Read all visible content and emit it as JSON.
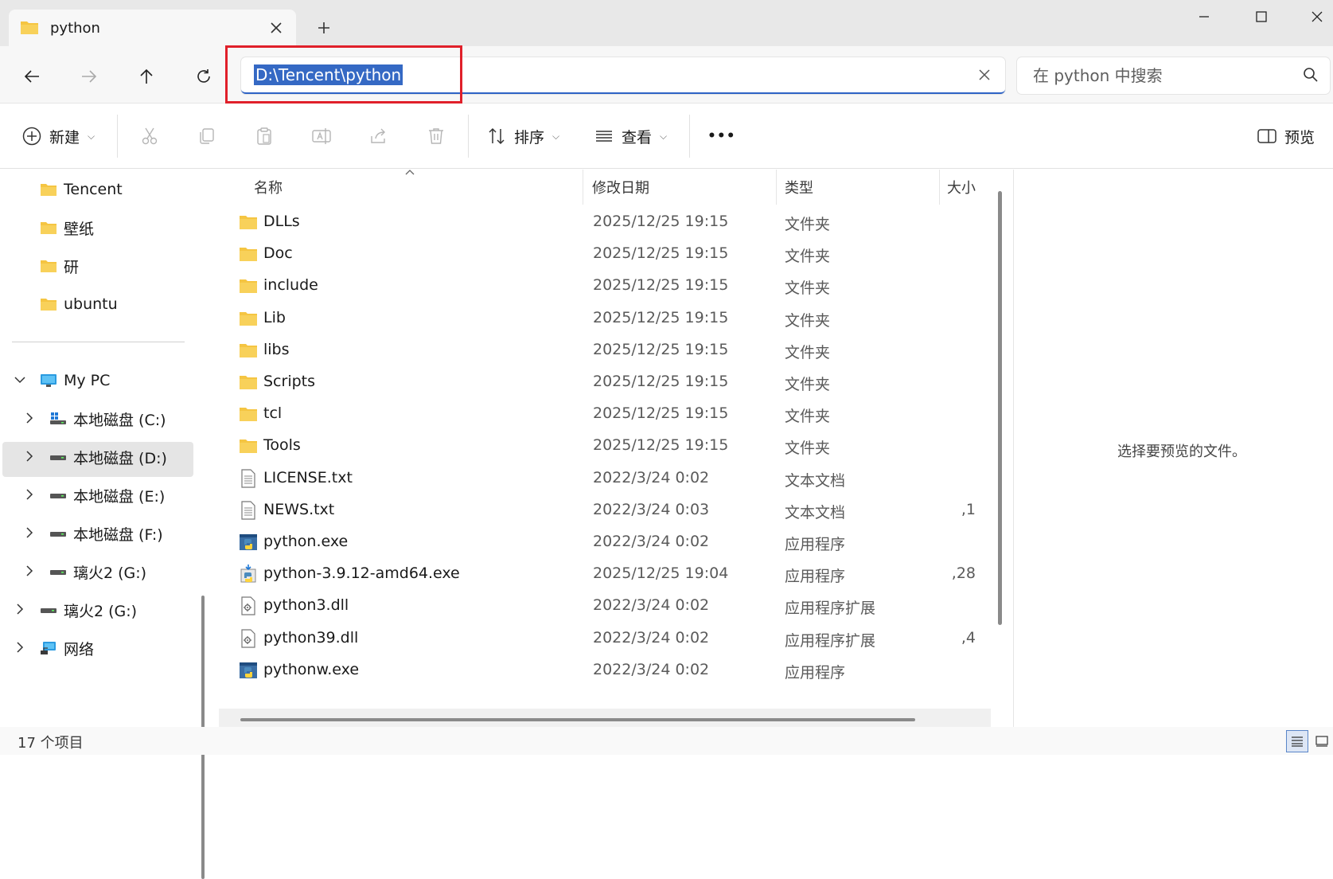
{
  "tab": {
    "title": "python"
  },
  "address": {
    "path": "D:\\Tencent\\python"
  },
  "search": {
    "placeholder": "在 python 中搜索"
  },
  "toolbar": {
    "new_label": "新建",
    "sort_label": "排序",
    "view_label": "查看",
    "more_label": "•••",
    "preview_label": "预览"
  },
  "sidebar": {
    "quick_items": [
      {
        "label": "Tencent"
      },
      {
        "label": "壁纸"
      },
      {
        "label": "研"
      },
      {
        "label": "ubuntu"
      }
    ],
    "tree": [
      {
        "label": "My PC",
        "icon": "monitor-icon",
        "expanded": true
      },
      {
        "label": "本地磁盘 (C:)",
        "icon": "windows-drive-icon"
      },
      {
        "label": "本地磁盘 (D:)",
        "icon": "drive-icon",
        "selected": true
      },
      {
        "label": "本地磁盘 (E:)",
        "icon": "drive-icon"
      },
      {
        "label": "本地磁盘 (F:)",
        "icon": "drive-icon"
      },
      {
        "label": "璃火2 (G:)",
        "icon": "drive-icon"
      },
      {
        "label": "璃火2 (G:)",
        "icon": "drive-icon"
      },
      {
        "label": "网络",
        "icon": "network-icon"
      }
    ]
  },
  "columns": {
    "name": "名称",
    "date": "修改日期",
    "type": "类型",
    "size": "大小"
  },
  "files": [
    {
      "name": "DLLs",
      "date": "2025/12/25 19:15",
      "type": "文件夹",
      "size": "",
      "icon": "folder"
    },
    {
      "name": "Doc",
      "date": "2025/12/25 19:15",
      "type": "文件夹",
      "size": "",
      "icon": "folder"
    },
    {
      "name": "include",
      "date": "2025/12/25 19:15",
      "type": "文件夹",
      "size": "",
      "icon": "folder"
    },
    {
      "name": "Lib",
      "date": "2025/12/25 19:15",
      "type": "文件夹",
      "size": "",
      "icon": "folder"
    },
    {
      "name": "libs",
      "date": "2025/12/25 19:15",
      "type": "文件夹",
      "size": "",
      "icon": "folder"
    },
    {
      "name": "Scripts",
      "date": "2025/12/25 19:15",
      "type": "文件夹",
      "size": "",
      "icon": "folder"
    },
    {
      "name": "tcl",
      "date": "2025/12/25 19:15",
      "type": "文件夹",
      "size": "",
      "icon": "folder"
    },
    {
      "name": "Tools",
      "date": "2025/12/25 19:15",
      "type": "文件夹",
      "size": "",
      "icon": "folder"
    },
    {
      "name": "LICENSE.txt",
      "date": "2022/3/24 0:02",
      "type": "文本文档",
      "size": "",
      "icon": "text"
    },
    {
      "name": "NEWS.txt",
      "date": "2022/3/24 0:03",
      "type": "文本文档",
      "size": "1,",
      "icon": "text"
    },
    {
      "name": "python.exe",
      "date": "2022/3/24 0:02",
      "type": "应用程序",
      "size": "",
      "icon": "python-exe"
    },
    {
      "name": "python-3.9.12-amd64.exe",
      "date": "2025/12/25 19:04",
      "type": "应用程序",
      "size": "28,",
      "icon": "installer"
    },
    {
      "name": "python3.dll",
      "date": "2022/3/24 0:02",
      "type": "应用程序扩展",
      "size": "",
      "icon": "dll"
    },
    {
      "name": "python39.dll",
      "date": "2022/3/24 0:02",
      "type": "应用程序扩展",
      "size": "4,",
      "icon": "dll"
    },
    {
      "name": "pythonw.exe",
      "date": "2022/3/24 0:02",
      "type": "应用程序",
      "size": "",
      "icon": "python-exe"
    }
  ],
  "preview": {
    "message": "选择要预览的文件。"
  },
  "status": {
    "item_count": "17 个项目"
  },
  "colors": {
    "accent": "#3569c4",
    "highlight_box": "#e0202a",
    "folder": "#f5c542"
  }
}
